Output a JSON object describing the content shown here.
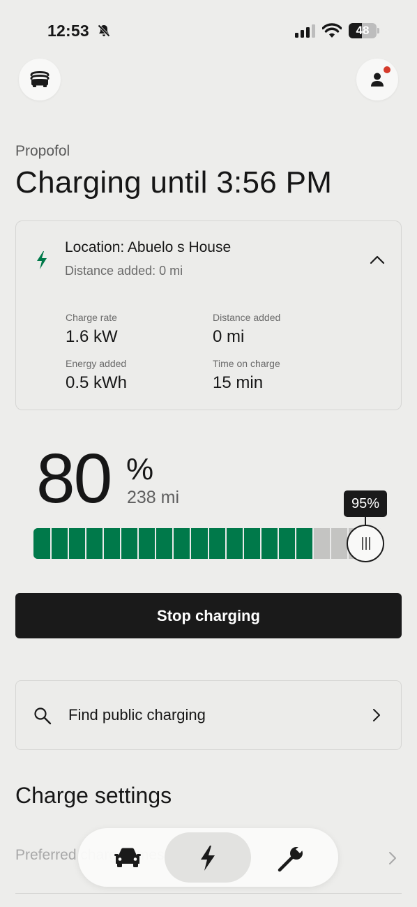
{
  "status_bar": {
    "time": "12:53",
    "battery": "48",
    "battery_level": 0.48,
    "icons": [
      "bell-slash-icon",
      "cellular-signal-icon",
      "wifi-icon",
      "battery-icon"
    ]
  },
  "header": {
    "menu_icon": "vehicle-menu-icon",
    "profile_icon": "profile-icon",
    "has_notification": true
  },
  "vehicle_name": "Propofol",
  "status_title": "Charging until 3:56 PM",
  "session": {
    "location": "Location: Abuelo s House",
    "subtitle": "Distance added: 0 mi",
    "expanded": true,
    "stats": [
      {
        "label": "Charge rate",
        "value": "1.6 kW"
      },
      {
        "label": "Distance added",
        "value": "0 mi"
      },
      {
        "label": "Energy added",
        "value": "0.5 kWh"
      },
      {
        "label": "Time on charge",
        "value": "15 min"
      }
    ]
  },
  "battery": {
    "percent": "80",
    "percent_sign": "%",
    "range": "238 mi",
    "level": 80,
    "limit": 95,
    "limit_label": "95%"
  },
  "actions": {
    "stop_label": "Stop charging",
    "find_label": "Find public charging"
  },
  "settings": {
    "title": "Charge settings",
    "first_row": "Preferred charge times"
  },
  "bottom_nav": {
    "items": [
      "car-icon",
      "charging-bolt-icon",
      "wrench-icon"
    ],
    "active": "charging-bolt-icon"
  },
  "colors": {
    "charge_green": "#00794a",
    "accent_dark": "#1a1a1a",
    "notification_red": "#d53b2b"
  }
}
